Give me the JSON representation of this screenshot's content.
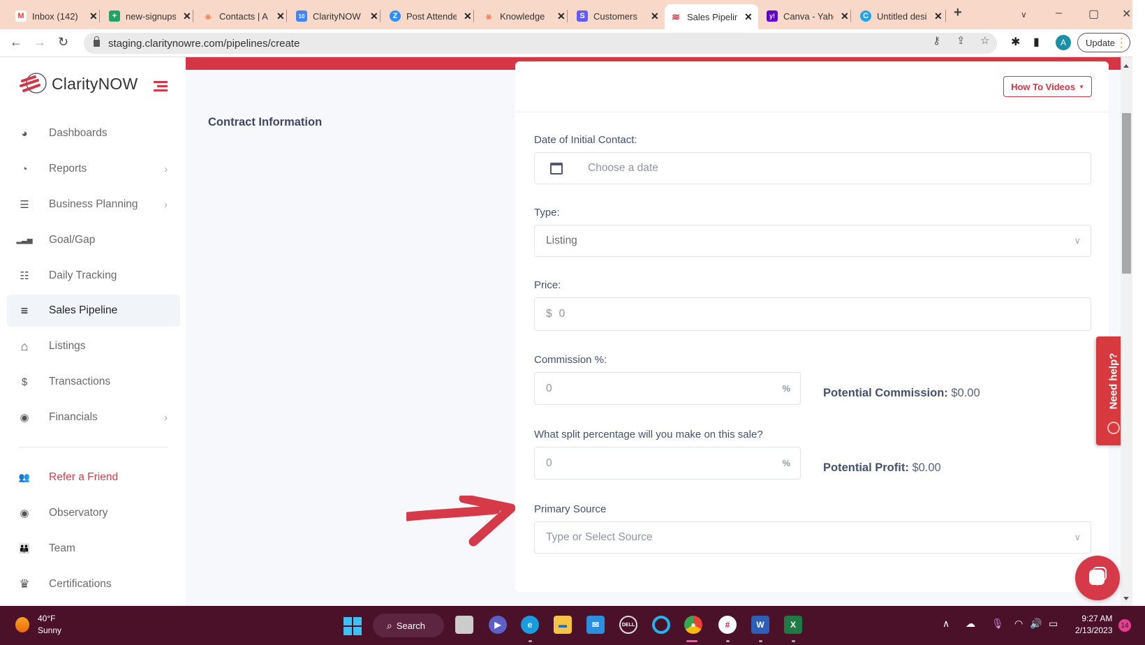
{
  "browser": {
    "tabs": [
      {
        "title": "Inbox (142)",
        "icon": "gmail-icon",
        "color": "#ea4335",
        "glyph": "M"
      },
      {
        "title": "new-signups",
        "icon": "sheets-icon",
        "color": "#1fa463",
        "glyph": "+"
      },
      {
        "title": "Contacts | A",
        "icon": "hubspot-icon",
        "color": "#ff7a59",
        "glyph": "⚹"
      },
      {
        "title": "ClarityNOW",
        "icon": "calendar-icon",
        "color": "#4285f4",
        "glyph": "10"
      },
      {
        "title": "Post Attendee",
        "icon": "zoom-icon",
        "color": "#2d8cff",
        "glyph": "Z"
      },
      {
        "title": "Knowledge",
        "icon": "hubspot-icon",
        "color": "#ff7a59",
        "glyph": "⚹"
      },
      {
        "title": "Customers",
        "icon": "stripe-icon",
        "color": "#635bff",
        "glyph": "S"
      },
      {
        "title": "Sales Pipeline",
        "icon": "claritynow-icon",
        "color": "#d63545",
        "glyph": "≋",
        "active": true
      },
      {
        "title": "Canva - Yahoo",
        "icon": "yahoo-icon",
        "color": "#6001d2",
        "glyph": "y!"
      },
      {
        "title": "Untitled design",
        "icon": "canva-icon",
        "color": "#20a4e8",
        "glyph": "C"
      }
    ],
    "new_tab_label": "+",
    "url": "staging.claritynowre.com/pipelines/create",
    "profile_initial": "A",
    "update_label": "Update"
  },
  "sidebar": {
    "brand": "ClarityNOW",
    "items": [
      {
        "label": "Dashboards",
        "icon": "dashboard-icon",
        "glyph": "◕",
        "chevron": false
      },
      {
        "label": "Reports",
        "icon": "pie-chart-icon",
        "glyph": "◔",
        "chevron": true
      },
      {
        "label": "Business Planning",
        "icon": "checklist-icon",
        "glyph": "☰",
        "chevron": true
      },
      {
        "label": "Goal/Gap",
        "icon": "signal-bars-icon",
        "glyph": "▂▃▅",
        "chevron": false
      },
      {
        "label": "Daily Tracking",
        "icon": "list-icon",
        "glyph": "☷",
        "chevron": false
      },
      {
        "label": "Sales Pipeline",
        "icon": "pipeline-icon",
        "glyph": "≡",
        "chevron": false,
        "active": true
      },
      {
        "label": "Listings",
        "icon": "home-icon",
        "glyph": "⌂",
        "chevron": false
      },
      {
        "label": "Transactions",
        "icon": "dollar-icon",
        "glyph": "$",
        "chevron": false
      },
      {
        "label": "Financials",
        "icon": "coins-icon",
        "glyph": "◉",
        "chevron": true
      },
      {
        "label": "Refer a Friend",
        "icon": "users-icon",
        "glyph": "👥",
        "chevron": false,
        "refer": true
      },
      {
        "label": "Observatory",
        "icon": "eye-icon",
        "glyph": "◉",
        "chevron": false
      },
      {
        "label": "Team",
        "icon": "team-icon",
        "glyph": "👪",
        "chevron": false
      },
      {
        "label": "Certifications",
        "icon": "crown-icon",
        "glyph": "♛",
        "chevron": false
      }
    ],
    "chevron_glyph": "›"
  },
  "main": {
    "section_title": "Contract Information",
    "how_to_videos": "How To Videos",
    "fields": {
      "date": {
        "label": "Date of Initial Contact:",
        "placeholder": "Choose a date"
      },
      "type": {
        "label": "Type:",
        "value": "Listing"
      },
      "price": {
        "label": "Price:",
        "prefix": "$",
        "value": "0"
      },
      "commission": {
        "label": "Commission %:",
        "value": "0",
        "suffix": "%"
      },
      "split": {
        "label": "What split percentage will you make on this sale?",
        "value": "0",
        "suffix": "%"
      },
      "source": {
        "label": "Primary Source",
        "placeholder": "Type or Select Source"
      }
    },
    "potential_commission": {
      "label": "Potential Commission:",
      "value": "$0.00"
    },
    "potential_profit": {
      "label": "Potential Profit:",
      "value": "$0.00"
    },
    "need_help": "Need help?"
  },
  "taskbar": {
    "temperature": "40°F",
    "condition": "Sunny",
    "search_label": "Search",
    "time": "9:27 AM",
    "date": "2/13/2023",
    "notifications": "14"
  },
  "colors": {
    "brand_red": "#d63545",
    "taskbar": "#4a1128",
    "tab_strip": "#f8d9c9"
  }
}
